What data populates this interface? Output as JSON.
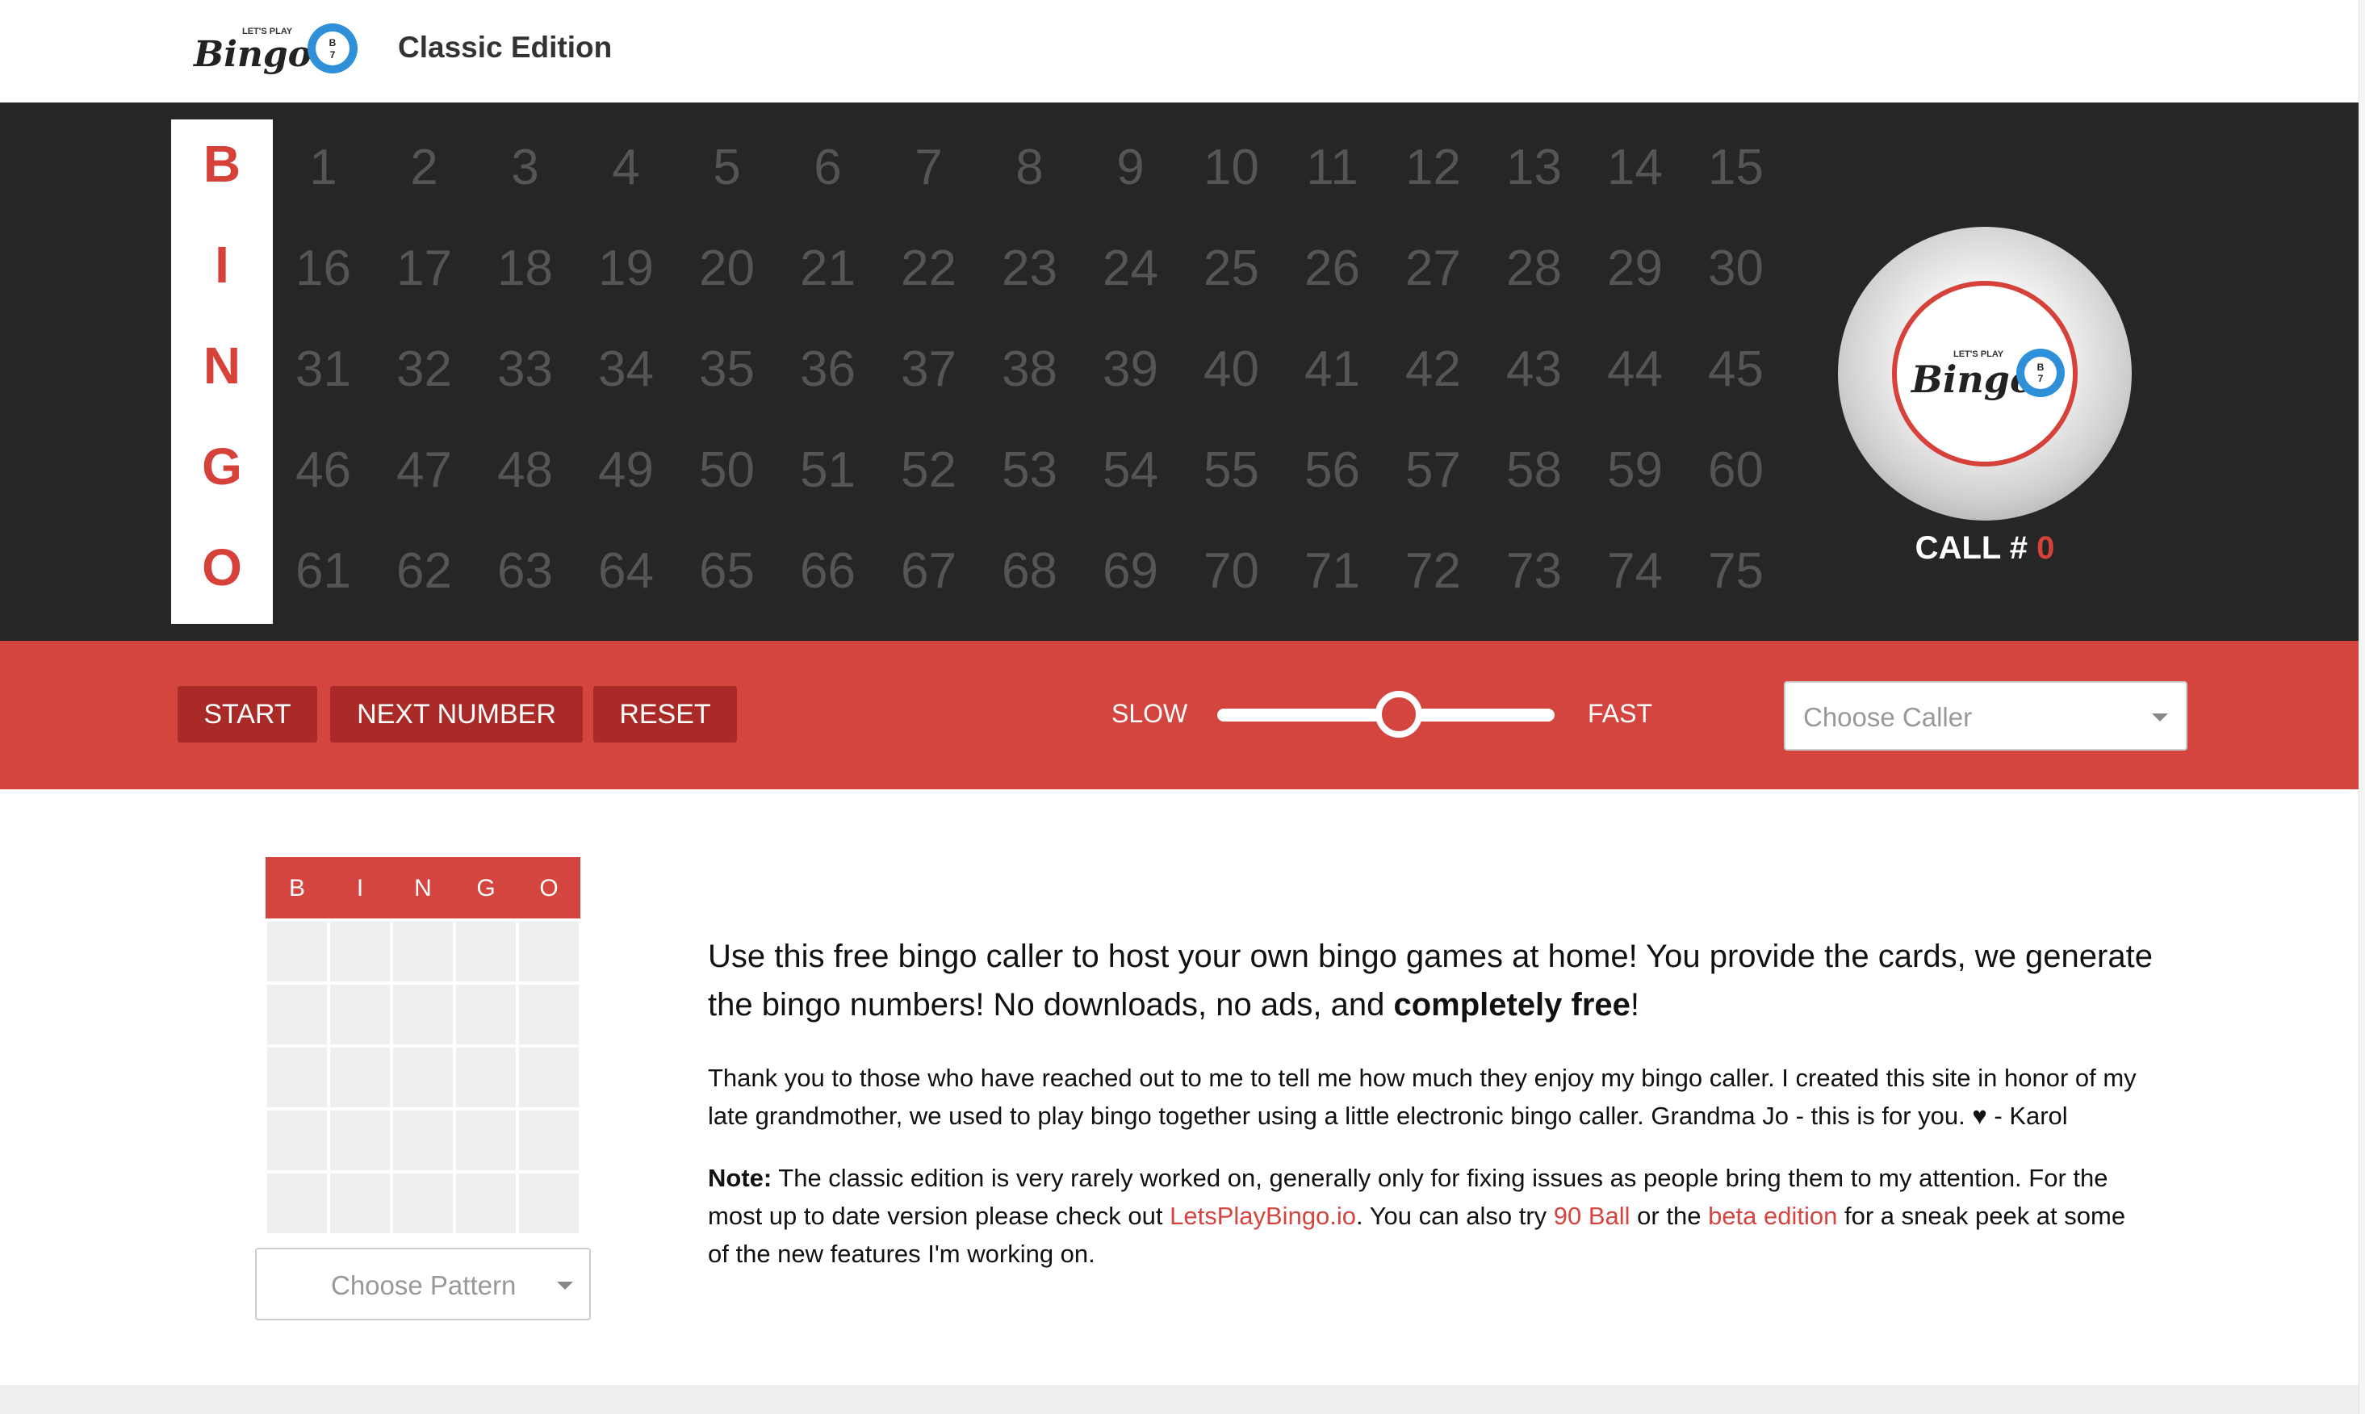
{
  "header": {
    "logo_small": "LET'S PLAY",
    "logo_main": "Bingo!",
    "logo_ball": "B 7",
    "edition": "Classic Edition"
  },
  "board": {
    "letters": [
      "B",
      "I",
      "N",
      "G",
      "O"
    ],
    "rows": [
      [
        "1",
        "2",
        "3",
        "4",
        "5",
        "6",
        "7",
        "8",
        "9",
        "10",
        "11",
        "12",
        "13",
        "14",
        "15"
      ],
      [
        "16",
        "17",
        "18",
        "19",
        "20",
        "21",
        "22",
        "23",
        "24",
        "25",
        "26",
        "27",
        "28",
        "29",
        "30"
      ],
      [
        "31",
        "32",
        "33",
        "34",
        "35",
        "36",
        "37",
        "38",
        "39",
        "40",
        "41",
        "42",
        "43",
        "44",
        "45"
      ],
      [
        "46",
        "47",
        "48",
        "49",
        "50",
        "51",
        "52",
        "53",
        "54",
        "55",
        "56",
        "57",
        "58",
        "59",
        "60"
      ],
      [
        "61",
        "62",
        "63",
        "64",
        "65",
        "66",
        "67",
        "68",
        "69",
        "70",
        "71",
        "72",
        "73",
        "74",
        "75"
      ]
    ],
    "call_label": "CALL # ",
    "call_value": "0"
  },
  "controls": {
    "start_label": "START",
    "next_label": "NEXT NUMBER",
    "reset_label": "RESET",
    "slow_label": "SLOW",
    "fast_label": "FAST",
    "speed_fraction": 0.5,
    "caller_placeholder": "Choose Caller"
  },
  "pattern": {
    "header": [
      "B",
      "I",
      "N",
      "G",
      "O"
    ],
    "placeholder": "Choose Pattern"
  },
  "content": {
    "intro_text": "Use this free bingo caller to host your own bingo games at home! You provide the cards, we generate the bingo numbers! No downloads, no ads, and ",
    "intro_bold": "completely free",
    "intro_end": "!",
    "thanks": "Thank you to those who have reached out to me to tell me how much they enjoy my bingo caller. I created this site in honor of my late grandmother, we used to play bingo together using a little electronic bingo caller. Grandma Jo - this is for you. ♥ - Karol",
    "note_label": "Note:",
    "note_1": " The classic edition is very rarely worked on, generally only for fixing issues as people bring them to my attention. For the most up to date version please check out ",
    "note_link_1": "LetsPlayBingo.io",
    "note_2": ". You can also try ",
    "note_link_2": "90 Ball",
    "note_3": " or the ",
    "note_link_3": "beta edition",
    "note_4": " for a sneak peek at some of the new features I'm working on."
  },
  "colors": {
    "accent": "#d4453f",
    "board_bg": "#262626",
    "button_dark": "#a92a26",
    "logo_blue": "#2f8fd8"
  }
}
